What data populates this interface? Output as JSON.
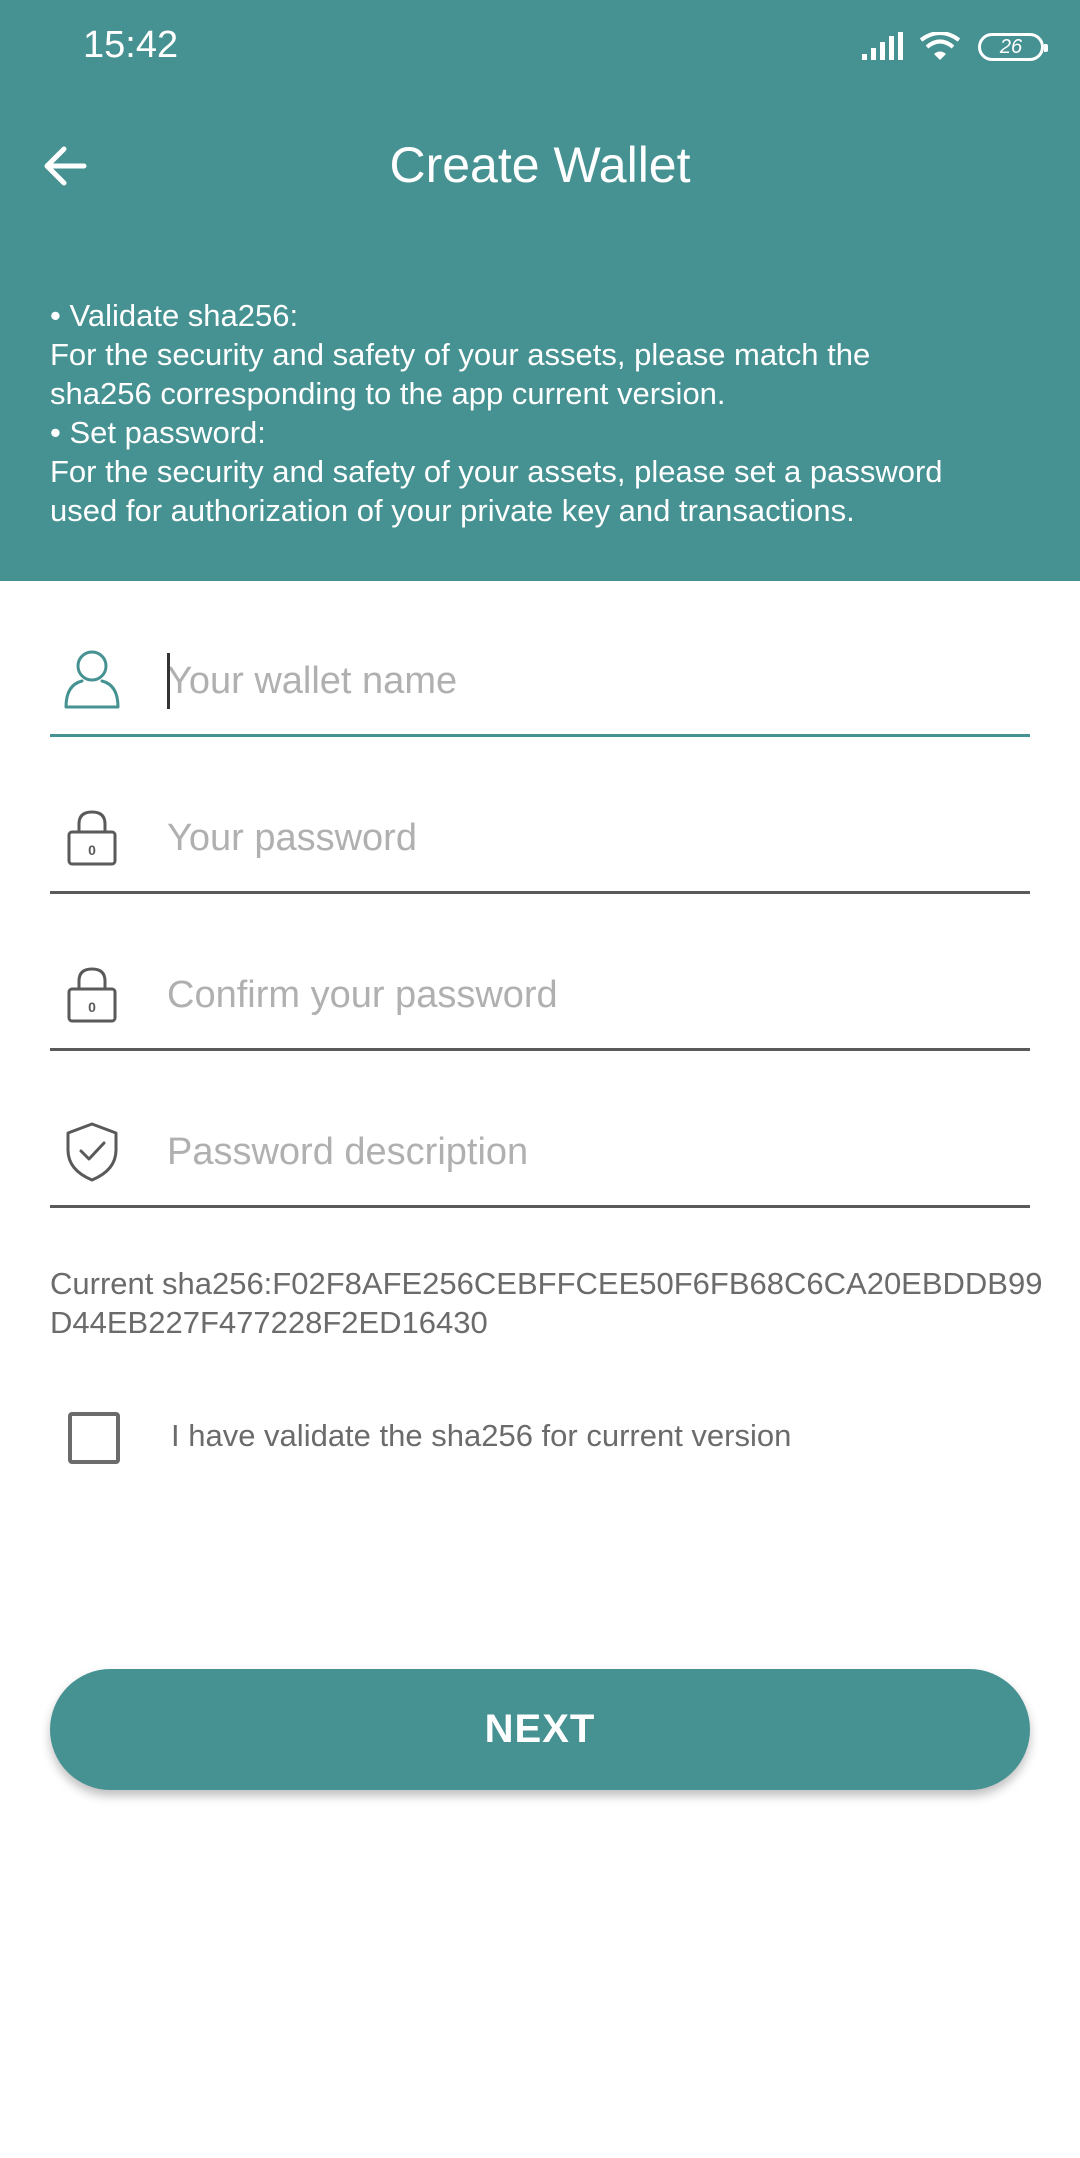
{
  "status_bar": {
    "time": "15:42",
    "battery": "26",
    "icons": [
      "signal-icon",
      "wifi-icon",
      "battery-icon"
    ]
  },
  "header": {
    "title": "Create Wallet",
    "back_icon": "arrow-left-icon",
    "info_lines": [
      "• Validate sha256:",
      "For the security and safety of your assets, please match the",
      "sha256 corresponding to the app current version.",
      "• Set password:",
      "For the security and safety of your assets, please set a password",
      "used for authorization of your private key and transactions."
    ]
  },
  "form": {
    "wallet_name": {
      "placeholder": "Your wallet name",
      "value": "",
      "icon": "user-icon"
    },
    "password": {
      "placeholder": "Your password",
      "value": "",
      "icon": "lock-icon"
    },
    "confirm_password": {
      "placeholder": "Confirm your password",
      "value": "",
      "icon": "lock-icon"
    },
    "password_description": {
      "placeholder": "Password description",
      "value": "",
      "icon": "shield-check-icon"
    }
  },
  "sha": {
    "text": "Current sha256:F02F8AFE256CEBFFCEE50F6FB68C6CA20EBDDB99D44EB227F477228F2ED16430"
  },
  "validation": {
    "label": "I have validate the sha256 for current version",
    "checked": false
  },
  "actions": {
    "next_label": "NEXT"
  },
  "colors": {
    "primary": "#469192",
    "text_gray": "#6b6b6b",
    "placeholder": "#b0b0b0"
  }
}
